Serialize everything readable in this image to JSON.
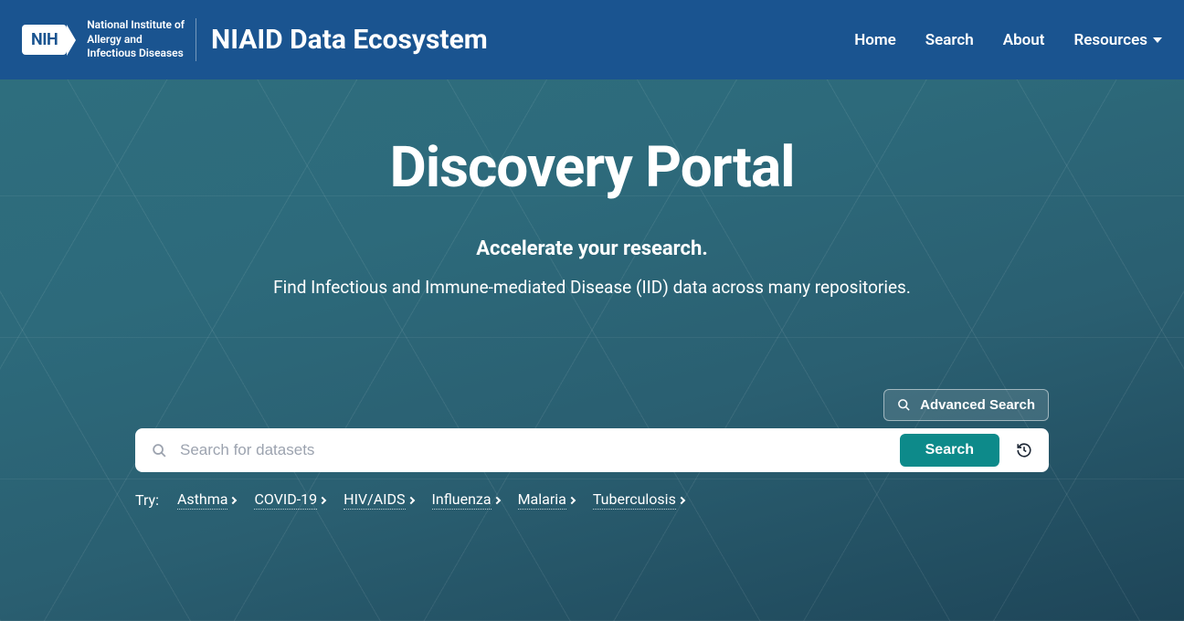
{
  "header": {
    "nih_logo_text": "NIH",
    "institute_line1": "National Institute of",
    "institute_line2": "Allergy and",
    "institute_line3": "Infectious Diseases",
    "site_title": "NIAID Data Ecosystem",
    "nav": {
      "home": "Home",
      "search": "Search",
      "about": "About",
      "resources": "Resources"
    }
  },
  "hero": {
    "title": "Discovery Portal",
    "subtitle": "Accelerate your research.",
    "description": "Find Infectious and Immune-mediated Disease (IID) data across many repositories."
  },
  "search": {
    "advanced_label": "Advanced Search",
    "placeholder": "Search for datasets",
    "button_label": "Search",
    "try_label": "Try:",
    "suggestions": [
      "Asthma",
      "COVID-19",
      "HIV/AIDS",
      "Influenza",
      "Malaria",
      "Tuberculosis"
    ]
  }
}
